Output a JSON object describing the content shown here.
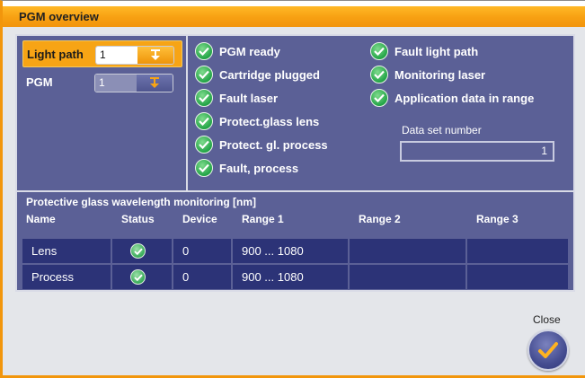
{
  "window": {
    "title": "PGM overview"
  },
  "left_panel": {
    "light_path": {
      "label": "Light path",
      "value": "1"
    },
    "pgm": {
      "label": "PGM",
      "value": "1"
    }
  },
  "status": {
    "col1": [
      "PGM ready",
      "Cartridge plugged",
      "Fault laser",
      "Protect.glass lens",
      "Protect. gl. process",
      "Fault, process"
    ],
    "col2": [
      "Fault light path",
      "Monitoring laser",
      "Application data in range"
    ]
  },
  "data_set": {
    "label": "Data set number",
    "value": "1"
  },
  "monitoring": {
    "title": "Protective glass wavelength monitoring [nm]",
    "headers": [
      "Name",
      "Status",
      "Device",
      "Range 1",
      "Range 2",
      "Range 3"
    ],
    "rows": [
      {
        "name": "Lens",
        "device": "0",
        "range1": "900 ... 1080",
        "range2": "",
        "range3": ""
      },
      {
        "name": "Process",
        "device": "0",
        "range1": "900 ... 1080",
        "range2": "",
        "range3": ""
      }
    ]
  },
  "close": {
    "label": "Close"
  },
  "colors": {
    "accent": "#f2960c",
    "panel": "#5b6096",
    "row": "#2c3377",
    "ok": "#23a447"
  }
}
